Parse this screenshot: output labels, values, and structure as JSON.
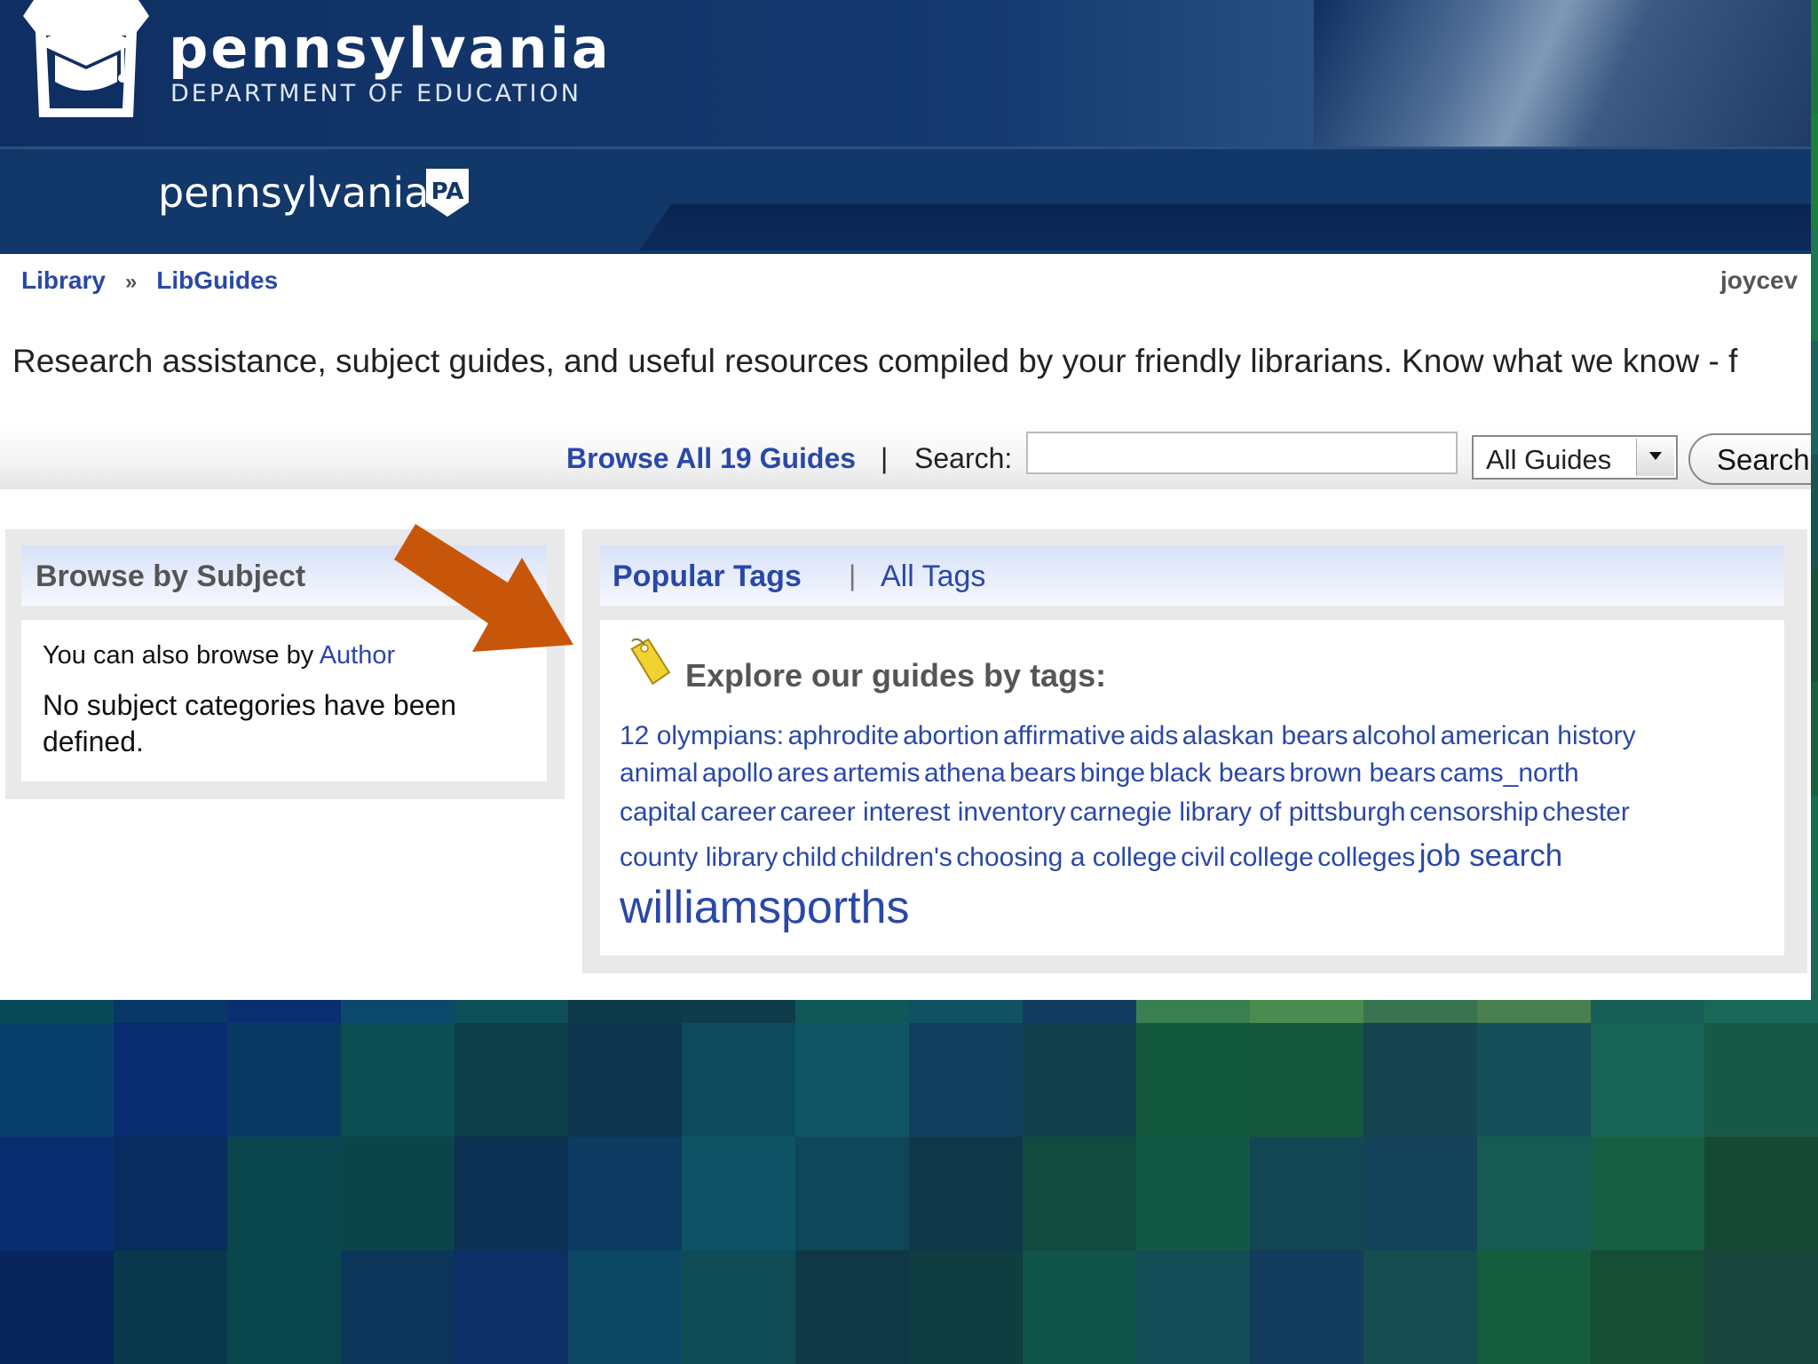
{
  "header": {
    "brand_title": "pennsylvania",
    "brand_subtitle": "DEPARTMENT OF EDUCATION",
    "state_wordmark": "pennsylvania",
    "state_badge": "PA"
  },
  "breadcrumb": {
    "items": [
      {
        "label": "Library"
      },
      {
        "label": "LibGuides"
      }
    ],
    "separator": "»"
  },
  "user": {
    "name": "joycev"
  },
  "tagline": "Research assistance, subject guides, and useful resources compiled by your friendly librarians. Know what we know - f",
  "search": {
    "browse_all_label": "Browse All 19 Guides",
    "separator": "|",
    "label": "Search:",
    "input_value": "",
    "scope_selected": "All Guides",
    "button_label": "Search"
  },
  "left_panel": {
    "title": "Browse by Subject",
    "author_prefix": "You can also browse by ",
    "author_link": "Author",
    "empty_message": "No subject categories have been defined."
  },
  "right_panel": {
    "tab_popular": "Popular Tags",
    "separator": "|",
    "tab_all": "All Tags",
    "explore_heading": "Explore our guides by tags:",
    "tag_rows": [
      [
        {
          "label": "12 olympians:",
          "size": "sm"
        },
        {
          "label": "aphrodite",
          "size": "sm"
        },
        {
          "label": "abortion",
          "size": "sm"
        },
        {
          "label": "affirmative",
          "size": "sm"
        },
        {
          "label": "aids",
          "size": "sm"
        },
        {
          "label": "alaskan bears",
          "size": "sm"
        },
        {
          "label": "alcohol",
          "size": "sm"
        },
        {
          "label": "american history",
          "size": "sm"
        }
      ],
      [
        {
          "label": "animal",
          "size": "sm"
        },
        {
          "label": "apollo",
          "size": "sm"
        },
        {
          "label": "ares",
          "size": "sm"
        },
        {
          "label": "artemis",
          "size": "sm"
        },
        {
          "label": "athena",
          "size": "sm"
        },
        {
          "label": "bears",
          "size": "sm"
        },
        {
          "label": "binge",
          "size": "sm"
        },
        {
          "label": "black bears",
          "size": "sm"
        },
        {
          "label": "brown bears",
          "size": "sm"
        },
        {
          "label": "cams_north",
          "size": "sm"
        }
      ],
      [
        {
          "label": "capital",
          "size": "sm"
        },
        {
          "label": "career",
          "size": "sm"
        },
        {
          "label": "career interest inventory",
          "size": "sm"
        },
        {
          "label": "carnegie library of pittsburgh",
          "size": "sm"
        },
        {
          "label": "censorship",
          "size": "sm"
        },
        {
          "label": "chester",
          "size": "sm"
        }
      ],
      [
        {
          "label": "county library",
          "size": "sm"
        },
        {
          "label": "child",
          "size": "sm"
        },
        {
          "label": "children's",
          "size": "sm"
        },
        {
          "label": "choosing a college",
          "size": "sm"
        },
        {
          "label": "civil",
          "size": "sm"
        },
        {
          "label": "college",
          "size": "sm"
        },
        {
          "label": "colleges",
          "size": "sm"
        },
        {
          "label": "job search",
          "size": "md"
        }
      ],
      [
        {
          "label": "williamsporths",
          "size": "lg"
        }
      ]
    ]
  },
  "annotation": {
    "arrow_color": "#c8560a"
  },
  "colors": {
    "link": "#2a48a8",
    "header_navy": "#0f2f62",
    "panel_header": "#d7e1f8"
  },
  "icons": [
    "keystone-logo-icon",
    "pa-badge-icon",
    "tag-icon",
    "dropdown-arrow-icon",
    "arrow-annotation-icon"
  ]
}
